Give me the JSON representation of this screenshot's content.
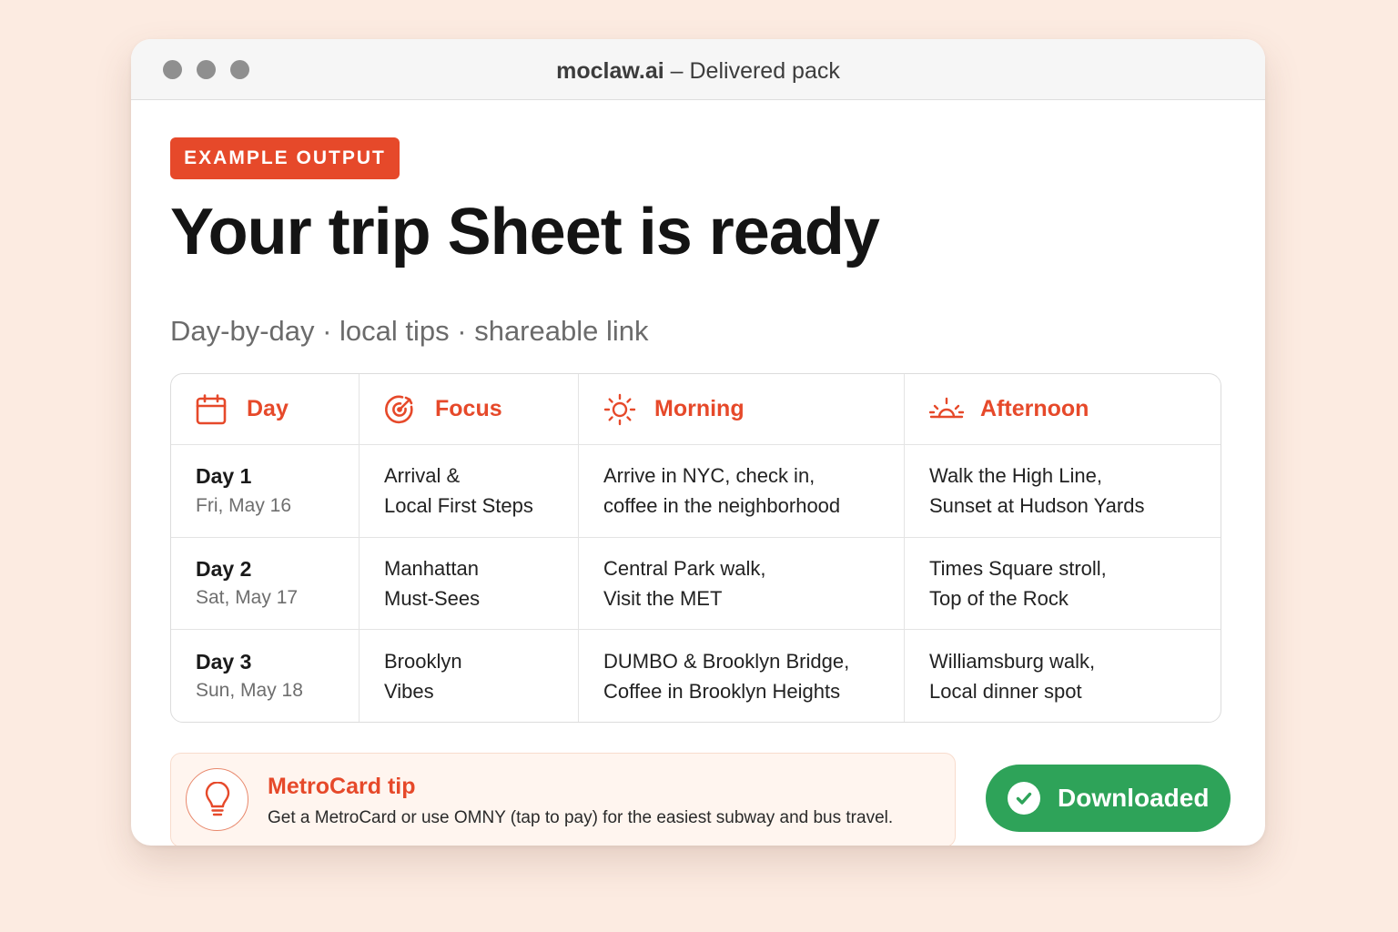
{
  "window": {
    "brand": "moclaw.ai",
    "title_suffix": " – Delivered pack"
  },
  "hero": {
    "badge": "EXAMPLE OUTPUT",
    "headline": "Your trip Sheet is ready",
    "subtitle": "Day-by-day · local tips · shareable link"
  },
  "table": {
    "headers": [
      {
        "label": "Day",
        "icon": "calendar-icon"
      },
      {
        "label": "Focus",
        "icon": "target-icon"
      },
      {
        "label": "Morning",
        "icon": "sun-icon"
      },
      {
        "label": "Afternoon",
        "icon": "sunset-icon"
      }
    ],
    "rows": [
      {
        "day": "Day 1",
        "date": "Fri, May 16",
        "focus": [
          "Arrival &",
          "Local First Steps"
        ],
        "morning": [
          "Arrive in NYC, check in,",
          "coffee in the neighborhood"
        ],
        "afternoon": [
          "Walk the High Line,",
          "Sunset at Hudson Yards"
        ]
      },
      {
        "day": "Day 2",
        "date": "Sat, May 17",
        "focus": [
          "Manhattan",
          "Must-Sees"
        ],
        "morning": [
          "Central Park walk,",
          "Visit the MET"
        ],
        "afternoon": [
          "Times Square stroll,",
          "Top of the Rock"
        ]
      },
      {
        "day": "Day 3",
        "date": "Sun, May 18",
        "focus": [
          "Brooklyn",
          "Vibes"
        ],
        "morning": [
          "DUMBO & Brooklyn Bridge,",
          "Coffee in Brooklyn Heights"
        ],
        "afternoon": [
          "Williamsburg walk,",
          "Local dinner spot"
        ]
      }
    ]
  },
  "tip": {
    "icon": "lightbulb-icon",
    "title": "MetroCard tip",
    "text": "Get a MetroCard or use OMNY (tap to pay) for the easiest subway and bus travel."
  },
  "download": {
    "label": "Downloaded",
    "icon": "check-circle-icon"
  },
  "colors": {
    "accent": "#e6492a",
    "success": "#2ea359",
    "background": "#fcebe1"
  }
}
